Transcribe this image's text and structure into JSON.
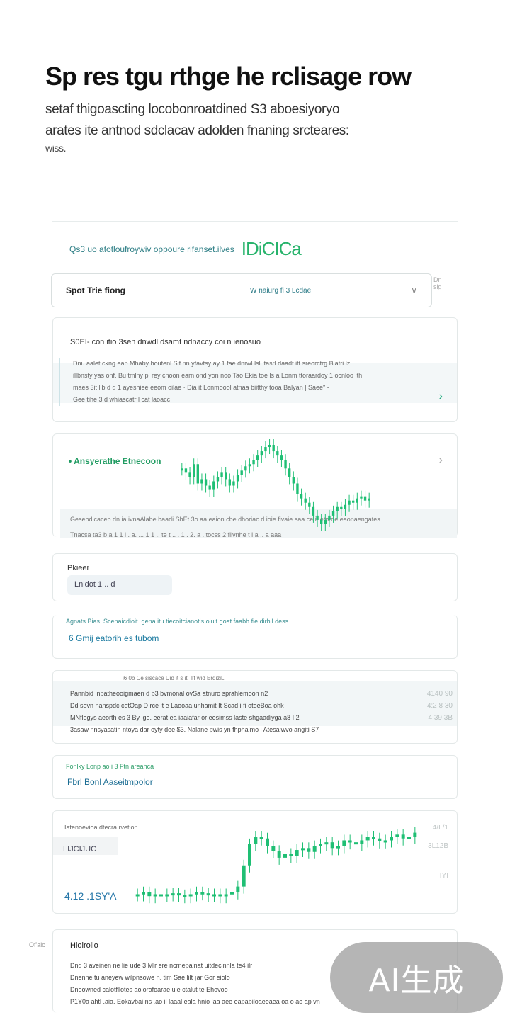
{
  "hero": {
    "title": "Sp res tgu rthge he rclisage row",
    "line1": "setaf thigoascting locobonroatdined S3 aboesiyoryo",
    "line2": "arates ite antnod sdclacav adolden fnaning srcteares:",
    "line3": "wiss."
  },
  "intro": {
    "text": "Qs3 uo atotloufroywiv oppoure rifanset.ilves",
    "tag": "IDiCICa"
  },
  "selector": {
    "label": "Spot Trie fiong",
    "value": "W naiurg fi 3 Lcdae",
    "side_note": "Dn\nsig"
  },
  "card1": {
    "heading": "S0EI- con itio 3sen dnwdl dsamt ndnaccy coi n ienosuo",
    "lines": [
      "Dnu aalet ckng eap Mhaby houtenl Sif nn yfavtsy ay 1 fae dnrwl lsl. tasrl daadt itt sreorctrg Blatri lz",
      "illbnsty yas onf. Bu tmlny pl rey cnoon earn ond yon noo Tao Ekia toe ls a Lonm ttoraardoy 1 ocnloo lth",
      "maes 3it lib d d 1 ayeshiee eeom oilae  · Dia it Lonmoool atnaa  biitthy tooa Balyan | Saee\"  -",
      "Gee tihe 3 d whiascatr l cat laoacc"
    ]
  },
  "card2": {
    "label": "Ansyerathe Etnecoon",
    "strip_line1": "Gesebdicaceb dn ia ivnaAlabe baadi ShEt 3o aa eaion cbe dhoriac d ioie fivaie saa ce it etnrde eaonaengates",
    "strip_line2": "Tnacsa ta3 b a 1  1   i  . a. ...  1    1 .. te  t ..  .  1  . 2. a  . tocss 2 fiivnhe t i  a ..  a  aaa"
  },
  "card3": {
    "label": "Pkieer",
    "chip": "Lnidot 1 .. d"
  },
  "card4": {
    "note": "Agnats Bias. Scenaicdioit. gena itu tiecoitcianotis oiuit goat faabh fie dirhil dess",
    "link": "6 Gmij eatorih es tubom"
  },
  "card5": {
    "caption": "i6 0b Ce siscace Uid it s iti Tf wid ErdiziL",
    "rows": [
      {
        "text": "Pannbid lnpatheooigmaen d b3 bvmonal ovSa atnuro sprahlemoon n2",
        "num": "4140  90"
      },
      {
        "text": "Dd sovn nanspdc cotOap D rce it e Laooaa unhamit It Scad i fi otoeBoa ohk",
        "num": "4:2 8  30"
      },
      {
        "text": "MNflogys aeorth es 3  By ige. eerat ea iaaiafar or eesimss laste shgaadiyga  a8 I 2",
        "num": "4  39  3B"
      },
      {
        "text": "3asaw nnsyasatin ntoya dar oyty dee $3. Nalane pwis yn fhphalmo i Atesaiwvo angiti S7",
        "num": ""
      }
    ]
  },
  "card6": {
    "note": "Fonlky Lonp ao i 3 Ftn areahca",
    "link": "Fbrl Bonl Aaseitmpolor"
  },
  "card7": {
    "label": "Iatenoevioa.dtecra rvetion",
    "sub": "LIJCIJUC",
    "value": "4.12 .1SY'A",
    "axis": [
      "4/L/1",
      "3L12B",
      "IYI"
    ]
  },
  "card8": {
    "side": "Of'aic",
    "label": "Hiolroiio",
    "lines": [
      "Dnd 3 aveinen ne lie ude 3 Mlr ere ncrnepalnat uitdecinnla te4 ilr",
      "Dnenne tu aneyew wilpnsowe n. tim Sae  lilt ¡ar  Gor eiolo",
      "Dnoowned calotfllotes aoiorofoarae uie ctalut te Ehovoo",
      "P1Y0a ahtl .aia. Eokavbai ns .ao il laaal eala hnio laa aee eapabiloaeeaea oa o  ao ap  vn"
    ]
  },
  "badge": "AI生成",
  "colors": {
    "accent_green": "#1fbf74",
    "accent_teal": "#2f7f86",
    "link_blue": "#1b7aa0",
    "card_border": "#e3e8e8"
  },
  "chart_data": [
    {
      "type": "bar",
      "title": "",
      "xlabel": "",
      "ylabel": "",
      "series": [
        {
          "values": [
            62,
            60,
            58,
            64,
            55,
            57,
            54,
            52,
            56,
            58,
            60,
            57,
            54,
            56,
            59,
            61,
            63,
            64,
            66,
            68,
            70,
            72,
            73,
            70,
            68,
            66,
            62,
            58,
            55,
            50,
            48,
            46,
            44,
            40,
            38,
            36,
            38,
            40,
            42,
            44,
            43,
            45,
            47,
            46,
            48,
            49,
            47,
            48
          ]
        }
      ]
    },
    {
      "type": "bar",
      "title": "",
      "xlabel": "",
      "ylabel": "",
      "series": [
        {
          "values": [
            10,
            12,
            8,
            10,
            9,
            10,
            11,
            9,
            8,
            10,
            12,
            11,
            9,
            10,
            8,
            10,
            12,
            18,
            40,
            62,
            70,
            68,
            60,
            55,
            48,
            52,
            50,
            56,
            58,
            54,
            60,
            62,
            64,
            58,
            60,
            66,
            64,
            62,
            66,
            70,
            68,
            65,
            66,
            70,
            72,
            68,
            70,
            74
          ]
        }
      ]
    }
  ]
}
